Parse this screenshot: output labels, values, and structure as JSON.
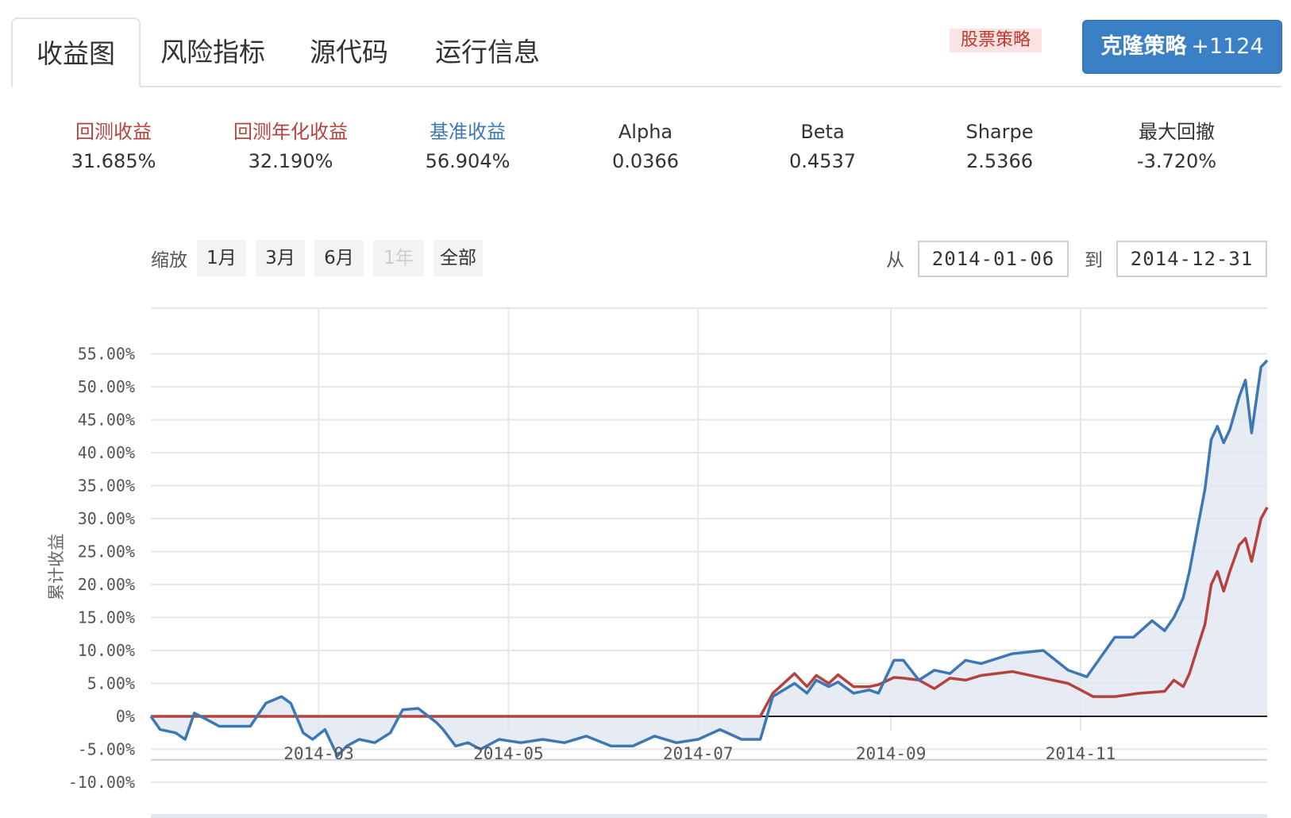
{
  "tabs": [
    {
      "label": "收益图",
      "active": true
    },
    {
      "label": "风险指标",
      "active": false
    },
    {
      "label": "源代码",
      "active": false
    },
    {
      "label": "运行信息",
      "active": false
    }
  ],
  "tag": "股票策略",
  "clone": {
    "label": "克隆策略",
    "count": "+1124"
  },
  "metrics": [
    {
      "label": "回测收益",
      "value": "31.685%"
    },
    {
      "label": "回测年化收益",
      "value": "32.190%"
    },
    {
      "label": "基准收益",
      "value": "56.904%"
    },
    {
      "label": "Alpha",
      "value": "0.0366"
    },
    {
      "label": "Beta",
      "value": "0.4537"
    },
    {
      "label": "Sharpe",
      "value": "2.5366"
    },
    {
      "label": "最大回撤",
      "value": "-3.720%"
    }
  ],
  "zoom": {
    "label": "缩放",
    "buttons": [
      "1月",
      "3月",
      "6月",
      "1年",
      "全部"
    ],
    "disabled": "1年"
  },
  "range": {
    "from_label": "从",
    "from": "2014-01-06",
    "to_label": "到",
    "to": "2014-12-31"
  },
  "colors": {
    "strategy": "#b5423d",
    "benchmark": "#3d78b4",
    "accent": "#3b7fc4"
  },
  "chart_data": {
    "type": "line",
    "ylabel": "累计收益",
    "ylim": [
      -10,
      57
    ],
    "yticks": [
      "-10.00%",
      "-5.00%",
      "0%",
      "5.00%",
      "10.00%",
      "15.00%",
      "20.00%",
      "25.00%",
      "30.00%",
      "35.00%",
      "40.00%",
      "45.00%",
      "50.00%",
      "55.00%"
    ],
    "ytick_values": [
      -10,
      -5,
      0,
      5,
      10,
      15,
      20,
      25,
      30,
      35,
      40,
      45,
      50,
      55
    ],
    "xticks": [
      "2014-03",
      "2014-05",
      "2014-07",
      "2014-09",
      "2014-11"
    ],
    "xtick_values": [
      "2014-03-01",
      "2014-05-01",
      "2014-07-01",
      "2014-09-01",
      "2014-11-01"
    ],
    "series": [
      {
        "name": "策略",
        "x": [
          "2014-01-06",
          "2014-07-21",
          "2014-07-25",
          "2014-08-01",
          "2014-08-05",
          "2014-08-08",
          "2014-08-12",
          "2014-08-15",
          "2014-08-20",
          "2014-08-25",
          "2014-08-28",
          "2014-09-02",
          "2014-09-05",
          "2014-09-10",
          "2014-09-15",
          "2014-09-20",
          "2014-09-25",
          "2014-09-30",
          "2014-10-10",
          "2014-10-20",
          "2014-10-28",
          "2014-11-05",
          "2014-11-12",
          "2014-11-20",
          "2014-11-28",
          "2014-12-01",
          "2014-12-04",
          "2014-12-06",
          "2014-12-09",
          "2014-12-11",
          "2014-12-13",
          "2014-12-15",
          "2014-12-17",
          "2014-12-19",
          "2014-12-22",
          "2014-12-24",
          "2014-12-26",
          "2014-12-29",
          "2014-12-31"
        ],
        "values": [
          0,
          0,
          3.5,
          6.5,
          4.5,
          6.2,
          5,
          6.3,
          4.5,
          4.5,
          4.8,
          5.9,
          5.8,
          5.5,
          4.2,
          5.8,
          5.5,
          6.2,
          6.8,
          5.8,
          5.0,
          3.0,
          3.0,
          3.5,
          3.8,
          5.5,
          4.5,
          6.5,
          11,
          14,
          20,
          22,
          19,
          22,
          26,
          27,
          23.5,
          30,
          31.7
        ]
      },
      {
        "name": "基准",
        "x": [
          "2014-01-06",
          "2014-01-09",
          "2014-01-14",
          "2014-01-17",
          "2014-01-20",
          "2014-01-24",
          "2014-01-28",
          "2014-02-07",
          "2014-02-12",
          "2014-02-17",
          "2014-02-20",
          "2014-02-24",
          "2014-02-27",
          "2014-03-03",
          "2014-03-07",
          "2014-03-10",
          "2014-03-14",
          "2014-03-19",
          "2014-03-24",
          "2014-03-28",
          "2014-04-02",
          "2014-04-08",
          "2014-04-10",
          "2014-04-14",
          "2014-04-18",
          "2014-04-22",
          "2014-04-28",
          "2014-05-05",
          "2014-05-12",
          "2014-05-19",
          "2014-05-26",
          "2014-06-03",
          "2014-06-10",
          "2014-06-17",
          "2014-06-24",
          "2014-07-01",
          "2014-07-08",
          "2014-07-15",
          "2014-07-21",
          "2014-07-25",
          "2014-08-01",
          "2014-08-05",
          "2014-08-08",
          "2014-08-12",
          "2014-08-15",
          "2014-08-20",
          "2014-08-25",
          "2014-08-28",
          "2014-09-02",
          "2014-09-05",
          "2014-09-10",
          "2014-09-15",
          "2014-09-20",
          "2014-09-25",
          "2014-09-30",
          "2014-10-10",
          "2014-10-20",
          "2014-10-28",
          "2014-11-03",
          "2014-11-12",
          "2014-11-18",
          "2014-11-24",
          "2014-11-28",
          "2014-12-01",
          "2014-12-04",
          "2014-12-06",
          "2014-12-09",
          "2014-12-11",
          "2014-12-13",
          "2014-12-15",
          "2014-12-17",
          "2014-12-19",
          "2014-12-22",
          "2014-12-24",
          "2014-12-26",
          "2014-12-29",
          "2014-12-31"
        ],
        "values": [
          0,
          -2,
          -2.5,
          -3.5,
          0.5,
          -0.5,
          -1.5,
          -1.5,
          2,
          3,
          2,
          -2.5,
          -3.5,
          -2,
          -6,
          -4.5,
          -3.5,
          -4,
          -2.5,
          1,
          1.2,
          -1,
          -2,
          -4.5,
          -4,
          -5,
          -3.5,
          -4,
          -3.5,
          -4,
          -3,
          -4.5,
          -4.5,
          -3,
          -4,
          -3.5,
          -2,
          -3.5,
          -3.5,
          3,
          5,
          3.5,
          5.5,
          4.5,
          5.2,
          3.5,
          4,
          3.5,
          8.5,
          8.5,
          5.5,
          7,
          6.5,
          8.5,
          8.0,
          9.5,
          10,
          7.0,
          6.0,
          12,
          12,
          14.5,
          13.0,
          15,
          18,
          22,
          29.5,
          34.5,
          42,
          44,
          41.5,
          43.5,
          48.5,
          51,
          43,
          53,
          54
        ]
      }
    ]
  }
}
